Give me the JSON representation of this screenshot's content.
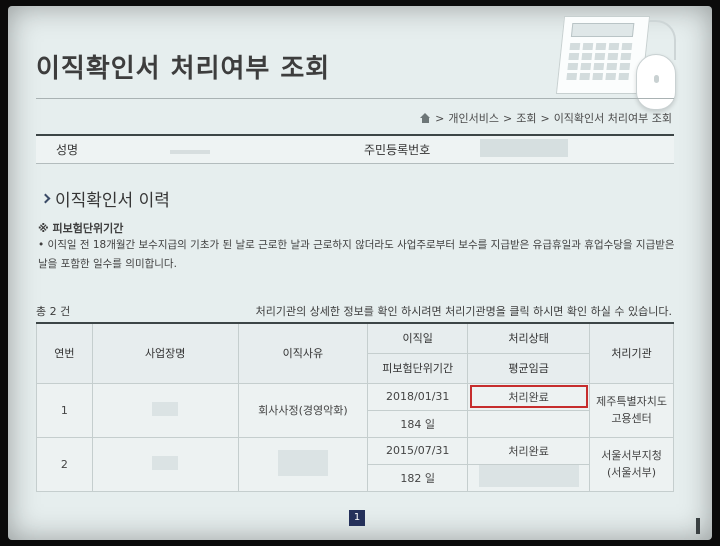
{
  "header": {
    "title": "이직확인서 처리여부 조회",
    "illustration_icons": [
      "calculator-icon",
      "mouse-icon"
    ]
  },
  "breadcrumb": {
    "home_icon": "home-icon",
    "items": [
      "개인서비스",
      "조회",
      "이직확인서 처리여부 조회"
    ],
    "separator": ">"
  },
  "info": {
    "name_label": "성명",
    "id_label": "주민등록번호"
  },
  "section": {
    "icon": "chevron-right-icon",
    "title": "이직확인서 이력"
  },
  "note": {
    "heading": "※ 피보험단위기간",
    "body": "• 이직일 전 18개월간 보수지급의 기초가 된 날로 근로한 날과 근로하지 않더라도 사업주로부터 보수를 지급받은 유급휴일과 휴업수당을 지급받은 날을 포함한 일수를 의미합니다."
  },
  "list": {
    "count_text": "총 2 건",
    "hint": "처리기관의 상세한 정보를 확인 하시려면 처리기관명을 클릭 하시면 확인 하실 수 있습니다."
  },
  "table": {
    "headers": {
      "no": "연번",
      "workplace": "사업장명",
      "reason": "이직사유",
      "date": "이직일",
      "period": "피보험단위기간",
      "status": "처리상태",
      "wage": "평균임금",
      "agency": "처리기관"
    },
    "rows": [
      {
        "no": "1",
        "reason": "회사사정(경영악화)",
        "date": "2018/01/31",
        "period": "184 일",
        "status": "처리완료",
        "agency": "제주특별자치도 고용센터"
      },
      {
        "no": "2",
        "date": "2015/07/31",
        "period": "182 일",
        "status": "처리완료",
        "agency": "서울서부지청(서울서부)"
      }
    ]
  },
  "pagination": {
    "current_page": "1"
  },
  "colors": {
    "accent_navy": "#24305a",
    "highlight_red": "#c62d2d",
    "panel_bg": "#e6eeee"
  }
}
